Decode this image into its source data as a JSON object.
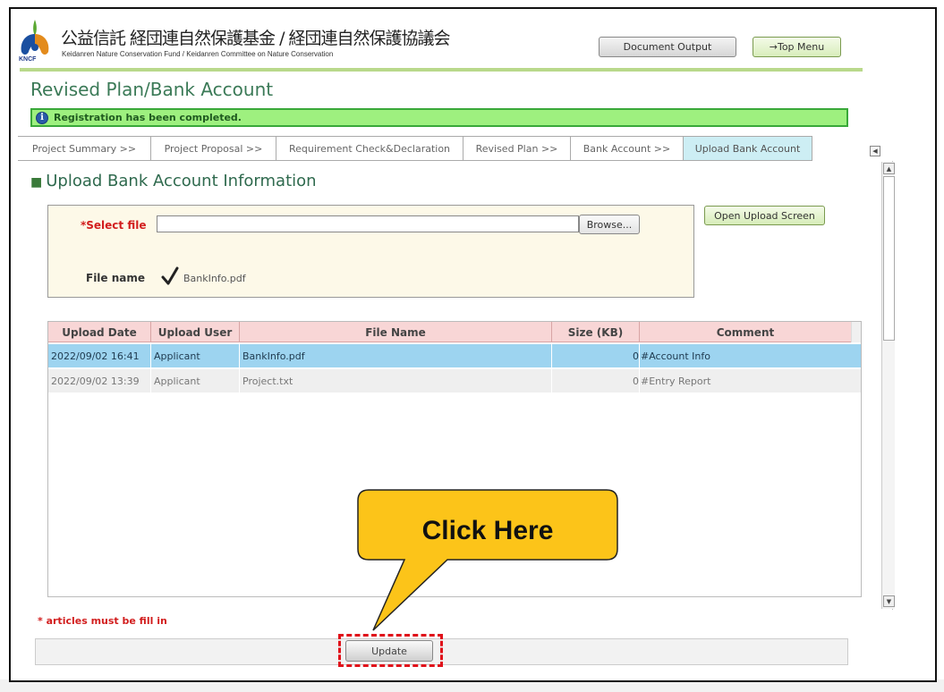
{
  "header": {
    "logo_text": "KNCF",
    "org_name_jp": "公益信託 経団連自然保護基金 / 経団連自然保護協議会",
    "org_name_en": "Keidanren Nature Conservation Fund / Keidanren Committee on Nature Conservation",
    "document_output_label": "Document Output",
    "top_menu_label": "→Top Menu"
  },
  "page_title": "Revised Plan/Bank Account",
  "message": "Registration has been completed.",
  "tabs": [
    {
      "label": "Project Summary >>",
      "active": false
    },
    {
      "label": "Project Proposal >>",
      "active": false
    },
    {
      "label": "Requirement Check&Declaration",
      "active": false
    },
    {
      "label": "Revised Plan >>",
      "active": false
    },
    {
      "label": "Bank Account >>",
      "active": false
    },
    {
      "label": "Upload Bank Account",
      "active": true
    }
  ],
  "section": {
    "title": "Upload Bank Account Information",
    "select_file_label": "*Select file",
    "file_input_value": "",
    "browse_label": "Browse...",
    "open_upload_label": "Open Upload Screen",
    "file_name_label": "File name",
    "file_name_value": "BankInfo.pdf"
  },
  "table": {
    "columns": [
      "Upload Date",
      "Upload User",
      "File Name",
      "Size (KB)",
      "Comment"
    ],
    "rows": [
      {
        "date": "2022/09/02 16:41",
        "user": "Applicant",
        "file": "BankInfo.pdf",
        "size": "0",
        "comment": "#Account Info",
        "selected": true
      },
      {
        "date": "2022/09/02 13:39",
        "user": "Applicant",
        "file": "Project.txt",
        "size": "0",
        "comment": "#Entry Report",
        "selected": false
      }
    ]
  },
  "callout": {
    "text": "Click Here"
  },
  "required_note": "* articles must be fill in",
  "update_label": "Update",
  "colors": {
    "accent_green": "#3b7a57",
    "message_bg": "#9ef07f",
    "selected_row": "#9dd4f0",
    "table_header": "#f8d6d6",
    "callout_fill": "#fcc419",
    "highlight_red": "#e0111a",
    "required_red": "#d21e1e"
  }
}
